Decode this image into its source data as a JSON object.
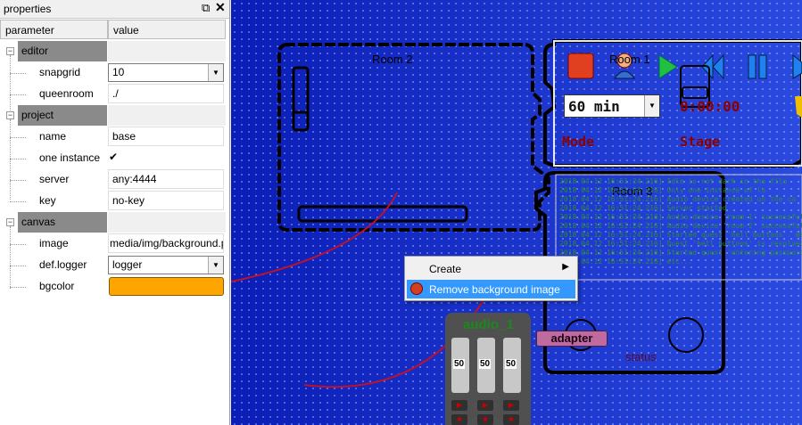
{
  "panel": {
    "title": "properties",
    "float_icon": "restore-icon",
    "close_icon": "close-icon",
    "headers": {
      "parameter": "parameter",
      "value": "value"
    },
    "groups": {
      "editor": "editor",
      "project": "project",
      "canvas": "canvas"
    },
    "props": {
      "snapgrid": {
        "label": "snapgrid",
        "value": "10"
      },
      "queenroom": {
        "label": "queenroom",
        "value": "./"
      },
      "name": {
        "label": "name",
        "value": "base"
      },
      "one_instance": {
        "label": "one instance",
        "value": "✔"
      },
      "server": {
        "label": "server",
        "value": "any:4444"
      },
      "key": {
        "label": "key",
        "value": "no-key"
      },
      "image": {
        "label": "image",
        "value": "media/img/background.png"
      },
      "def_logger": {
        "label": "def.logger",
        "value": "logger"
      },
      "bgcolor": {
        "label": "bgcolor",
        "value": "#ffa500"
      }
    }
  },
  "canvas": {
    "room2": "Room 2",
    "room1": "Room 1",
    "room3": "Room 3",
    "timer_select": "60 min",
    "time_display": "0:00:00",
    "mode_label": "Mode",
    "stage_label": "Stage",
    "adapter_label": "adapter",
    "status_label": "status",
    "audio_title": "audio_1",
    "audio_levels": [
      "50",
      "50",
      "50"
    ],
    "log_lines": [
      "2018.04.12 16:51:24.216] Idle is not dark in the file",
      "2018.04.12 16:51:24.216] Only one instance of lo",
      "2018.04.12 16:51:24.216] Audio device created on the ca",
      "2018.04.12 16:51:24.216] Server started",
      "2018.04.12 16:51:24.216] Audio device 'room-1' successfully in",
      "2018.04.12 16:51:24.216] Audio device 'room-2' successfully in",
      "2018.04.12 16:51:24.216] Started quest 'hell buttons'. Waiting",
      "2018.04.12 16:51:24.216] Quest 'hell buttons' is resolved",
      "2018.04.12 16:51:24.216] Started quest 'entering password'. W",
      "2018.04.12 16:51:24.216] etc..."
    ],
    "colors": {
      "accent_red": "#8b0000",
      "annotation_arrow": "#c0102a",
      "adapter_bg": "#c06ba0",
      "panel_bg": "#ffa500"
    }
  },
  "context_menu": {
    "create": "Create",
    "remove_bg": "Remove background image"
  }
}
